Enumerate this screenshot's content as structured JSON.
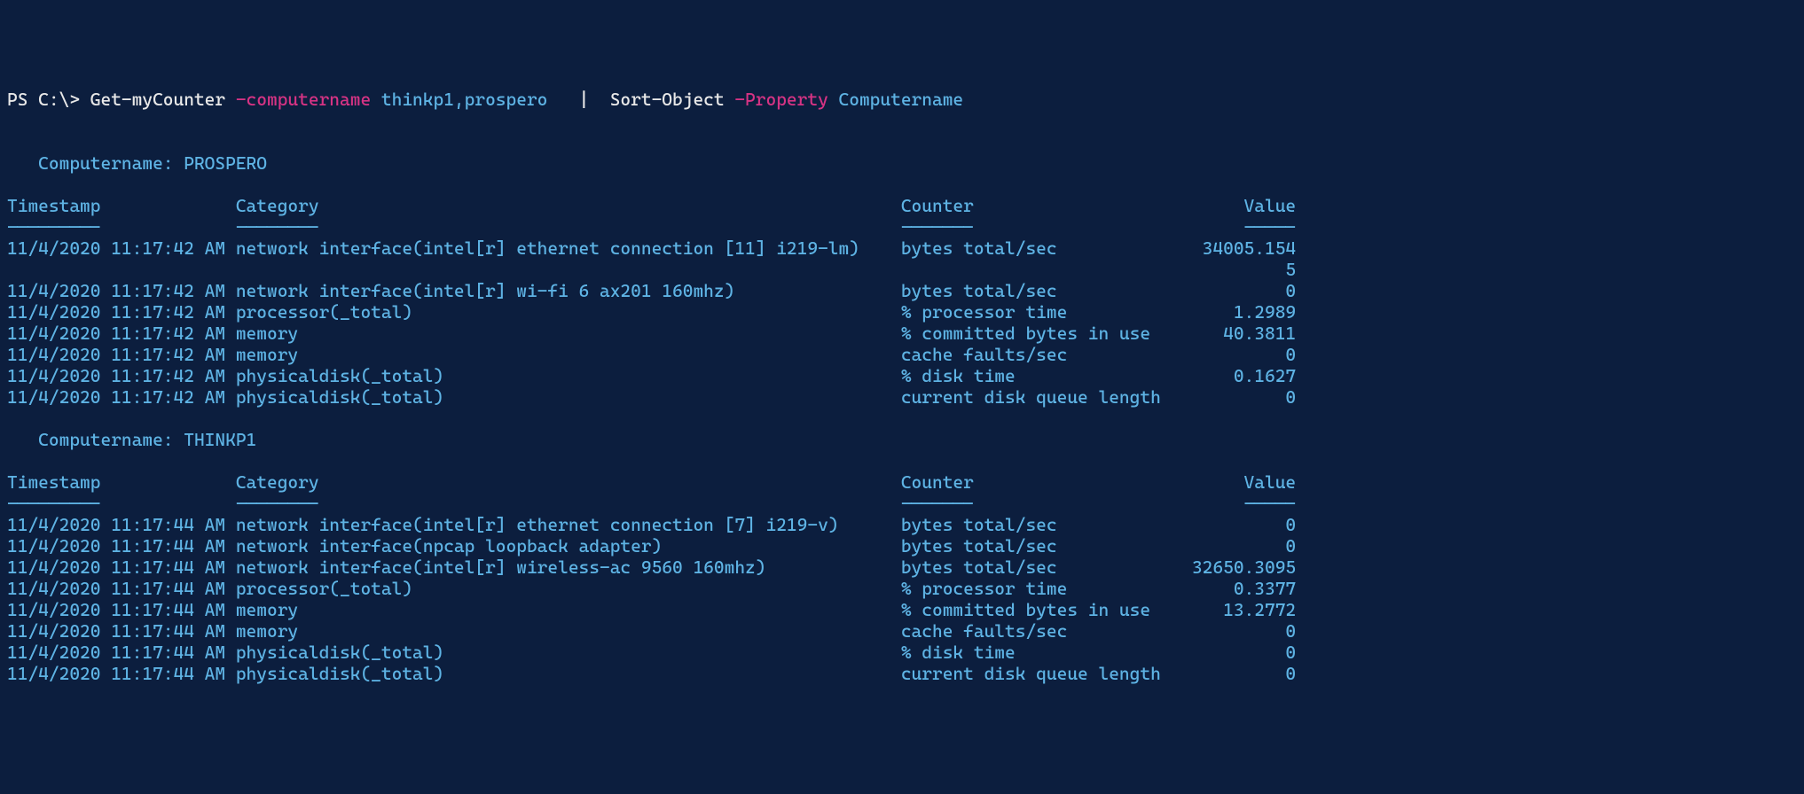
{
  "prompt": {
    "ps": "PS C:\\> ",
    "cmd1": "Get-myCounter",
    "param1": " -computername",
    "arg1": " thinkp1,prospero  ",
    "pipe": " | ",
    "cmd2": " Sort-Object",
    "param2": " -Property",
    "arg2": " Computername"
  },
  "columns": {
    "timestamp_header": "Timestamp",
    "category_header": "Category",
    "counter_header": "Counter",
    "value_header": "Value",
    "timestamp_sep": "---------",
    "category_sep": "--------",
    "counter_sep": "-------",
    "value_sep": "-----",
    "widths": {
      "timestamp": 21,
      "category": 63,
      "counter": 27,
      "value": 10
    }
  },
  "groups": [
    {
      "label": "   Computername: PROSPERO",
      "rows": [
        {
          "timestamp": "11/4/2020 11:17:42 AM",
          "category": "network interface(intel[r] ethernet connection [11] i219-lm)",
          "counter": "bytes total/sec",
          "value": "34005.154",
          "value_overflow": "5"
        },
        {
          "timestamp": "11/4/2020 11:17:42 AM",
          "category": "network interface(intel[r] wi-fi 6 ax201 160mhz)",
          "counter": "bytes total/sec",
          "value": "0"
        },
        {
          "timestamp": "11/4/2020 11:17:42 AM",
          "category": "processor(_total)",
          "counter": "% processor time",
          "value": "1.2989"
        },
        {
          "timestamp": "11/4/2020 11:17:42 AM",
          "category": "memory",
          "counter": "% committed bytes in use",
          "value": "40.3811"
        },
        {
          "timestamp": "11/4/2020 11:17:42 AM",
          "category": "memory",
          "counter": "cache faults/sec",
          "value": "0"
        },
        {
          "timestamp": "11/4/2020 11:17:42 AM",
          "category": "physicaldisk(_total)",
          "counter": "% disk time",
          "value": "0.1627"
        },
        {
          "timestamp": "11/4/2020 11:17:42 AM",
          "category": "physicaldisk(_total)",
          "counter": "current disk queue length",
          "value": "0"
        }
      ]
    },
    {
      "label": "   Computername: THINKP1",
      "rows": [
        {
          "timestamp": "11/4/2020 11:17:44 AM",
          "category": "network interface(intel[r] ethernet connection [7] i219-v)",
          "counter": "bytes total/sec",
          "value": "0"
        },
        {
          "timestamp": "11/4/2020 11:17:44 AM",
          "category": "network interface(npcap loopback adapter)",
          "counter": "bytes total/sec",
          "value": "0"
        },
        {
          "timestamp": "11/4/2020 11:17:44 AM",
          "category": "network interface(intel[r] wireless-ac 9560 160mhz)",
          "counter": "bytes total/sec",
          "value": "32650.3095"
        },
        {
          "timestamp": "11/4/2020 11:17:44 AM",
          "category": "processor(_total)",
          "counter": "% processor time",
          "value": "0.3377"
        },
        {
          "timestamp": "11/4/2020 11:17:44 AM",
          "category": "memory",
          "counter": "% committed bytes in use",
          "value": "13.2772"
        },
        {
          "timestamp": "11/4/2020 11:17:44 AM",
          "category": "memory",
          "counter": "cache faults/sec",
          "value": "0"
        },
        {
          "timestamp": "11/4/2020 11:17:44 AM",
          "category": "physicaldisk(_total)",
          "counter": "% disk time",
          "value": "0"
        },
        {
          "timestamp": "11/4/2020 11:17:44 AM",
          "category": "physicaldisk(_total)",
          "counter": "current disk queue length",
          "value": "0"
        }
      ]
    }
  ]
}
